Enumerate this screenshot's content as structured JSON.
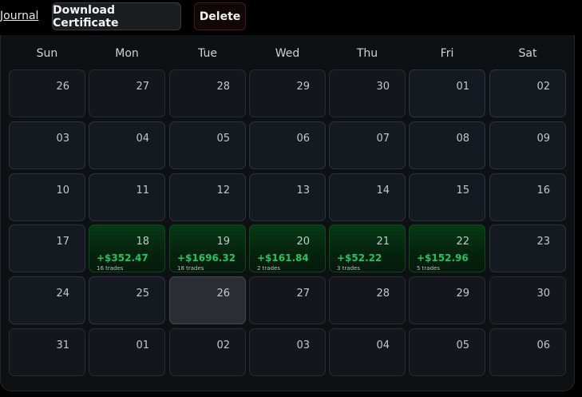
{
  "header": {
    "journal_label": "Journal",
    "download_label": "Download Certificate",
    "delete_label": "Delete"
  },
  "calendar": {
    "weekdays": [
      "Sun",
      "Mon",
      "Tue",
      "Wed",
      "Thu",
      "Fri",
      "Sat"
    ],
    "weeks": [
      [
        {
          "day": "26"
        },
        {
          "day": "27"
        },
        {
          "day": "28"
        },
        {
          "day": "29"
        },
        {
          "day": "30"
        },
        {
          "day": "01",
          "current": true
        },
        {
          "day": "02",
          "current": true
        }
      ],
      [
        {
          "day": "03",
          "current": true
        },
        {
          "day": "04",
          "current": true
        },
        {
          "day": "05",
          "current": true
        },
        {
          "day": "06",
          "current": true
        },
        {
          "day": "07",
          "current": true
        },
        {
          "day": "08",
          "current": true
        },
        {
          "day": "09",
          "current": true
        }
      ],
      [
        {
          "day": "10",
          "current": true
        },
        {
          "day": "11",
          "current": true
        },
        {
          "day": "12",
          "current": true
        },
        {
          "day": "13",
          "current": true
        },
        {
          "day": "14",
          "current": true
        },
        {
          "day": "15",
          "current": true
        },
        {
          "day": "16",
          "current": true
        }
      ],
      [
        {
          "day": "17",
          "current": true
        },
        {
          "day": "18",
          "pnl": "+$352.47",
          "trades": "16 trades"
        },
        {
          "day": "19",
          "pnl": "+$1696.32",
          "trades": "18 trades"
        },
        {
          "day": "20",
          "pnl": "+$161.84",
          "trades": "2 trades"
        },
        {
          "day": "21",
          "pnl": "+$52.22",
          "trades": "3 trades"
        },
        {
          "day": "22",
          "pnl": "+$152.96",
          "trades": "5 trades"
        },
        {
          "day": "23",
          "current": true
        }
      ],
      [
        {
          "day": "24",
          "current": true
        },
        {
          "day": "25",
          "current": true
        },
        {
          "day": "26",
          "today": true
        },
        {
          "day": "27"
        },
        {
          "day": "28"
        },
        {
          "day": "29"
        },
        {
          "day": "30"
        }
      ],
      [
        {
          "day": "31"
        },
        {
          "day": "01"
        },
        {
          "day": "02"
        },
        {
          "day": "03"
        },
        {
          "day": "04"
        },
        {
          "day": "05"
        },
        {
          "day": "06"
        }
      ]
    ]
  },
  "colors": {
    "profit_text": "#22c55e",
    "profit_bg": "#063a13"
  }
}
